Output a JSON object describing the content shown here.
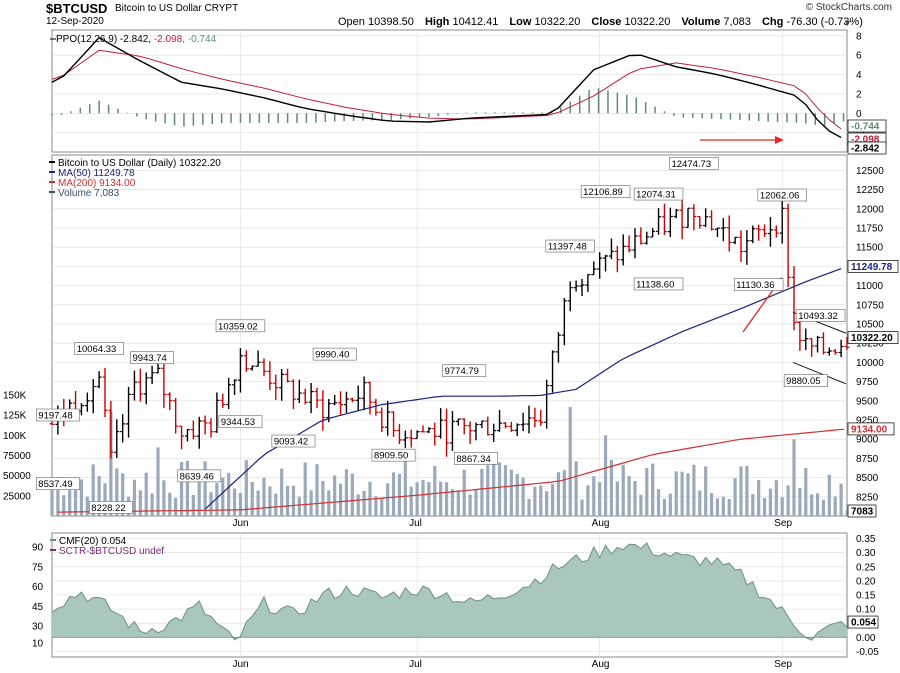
{
  "header": {
    "symbol": "$BTCUSD",
    "description": "Bitcoin to US Dollar  CRYPT",
    "date": "12-Sep-2020",
    "copyright": "© StockCharts.com",
    "open_label": "Open",
    "open": "10398.50",
    "high_label": "High",
    "high": "10412.41",
    "low_label": "Low",
    "low": "10322.20",
    "close_label": "Close",
    "close": "10322.20",
    "volume_label": "Volume",
    "volume": "7,083",
    "chg_label": "Chg",
    "chg": "-76.30 (-0.73%)",
    "dropdown_glyph": "▼"
  },
  "colors": {
    "up_bar": "#000000",
    "down_bar": "#cc0000",
    "ma50": "#1a237e",
    "ma200": "#d32f2f",
    "volume": "#9aaabb",
    "ppo_hist": "#5f8c72",
    "ppo_line": "#000000",
    "ppo_signal": "#c0203a",
    "cmf_fill": "#a9c7bf",
    "cmf_line": "#6d8f88",
    "sctr": "#7a2c7a",
    "arrow": "#ee2222",
    "grid": "#dcdcdc"
  },
  "chart_data": [
    {
      "type": "line",
      "panel": "PPO",
      "legend": "PPO(12,26,9) -2.842, -2.098, -0.744",
      "legend_parts": [
        "PPO(12,26,9) -2.842,",
        "-2.098,",
        "-0.744"
      ],
      "ylim": [
        -4,
        8.6
      ],
      "yticks": [
        8,
        6,
        4,
        2,
        0,
        -2
      ],
      "x_dates": [
        "2020-05-01",
        "2020-05-08",
        "2020-05-15",
        "2020-05-22",
        "2020-05-29",
        "2020-06-05",
        "2020-06-12",
        "2020-06-19",
        "2020-06-26",
        "2020-07-03",
        "2020-07-10",
        "2020-07-17",
        "2020-07-24",
        "2020-07-31",
        "2020-08-07",
        "2020-08-14",
        "2020-08-21",
        "2020-08-28",
        "2020-09-04",
        "2020-09-08",
        "2020-09-12"
      ],
      "series": [
        {
          "name": "PPO",
          "values": [
            3.2,
            7.8,
            5.4,
            3.2,
            2.5,
            1.6,
            0.5,
            -0.2,
            -0.8,
            -0.9,
            -0.5,
            -0.3,
            -0.1,
            4.5,
            6.2,
            4.8,
            4.0,
            2.9,
            1.7,
            -1.5,
            -2.842
          ]
        },
        {
          "name": "Signal",
          "values": [
            3.5,
            6.5,
            5.9,
            4.6,
            3.5,
            2.6,
            1.5,
            0.6,
            -0.1,
            -0.5,
            -0.6,
            -0.4,
            -0.2,
            1.8,
            4.5,
            5.2,
            4.6,
            3.7,
            2.7,
            -0.2,
            -2.098
          ]
        },
        {
          "name": "Histogram",
          "values": [
            -0.3,
            1.3,
            -0.5,
            -1.4,
            -1.0,
            -1.0,
            -1.0,
            -0.8,
            -0.7,
            -0.4,
            0.1,
            0.1,
            0.1,
            2.7,
            1.7,
            -0.4,
            -0.6,
            -0.8,
            -1.0,
            -1.3,
            -0.744
          ]
        }
      ],
      "value_tags": [
        "-0.744",
        "-2.098",
        "-2.842"
      ]
    },
    {
      "type": "bar",
      "panel": "Price",
      "legend": [
        "Bitcoin to US Dollar (Daily) 10322.20",
        "MA(50) 11249.78",
        "MA(200) 9134.00",
        "Volume 7,083"
      ],
      "ylim": [
        8000,
        12700
      ],
      "yticks": [
        12500,
        12250,
        12000,
        11750,
        11500,
        11250,
        11000,
        10750,
        10500,
        10250,
        10000,
        9750,
        9500,
        9250,
        9000,
        8750,
        8500,
        8250
      ],
      "xticks": [
        "Jun",
        "Jul",
        "Aug",
        "Sep"
      ],
      "price_path": {
        "dates": [
          "2020-04-30",
          "2020-05-08",
          "2020-05-10",
          "2020-05-14",
          "2020-05-18",
          "2020-05-22",
          "2020-05-27",
          "2020-06-01",
          "2020-06-08",
          "2020-06-15",
          "2020-06-22",
          "2020-06-27",
          "2020-07-05",
          "2020-07-15",
          "2020-07-22",
          "2020-07-27",
          "2020-08-02",
          "2020-08-10",
          "2020-08-17",
          "2020-08-25",
          "2020-09-01",
          "2020-09-03",
          "2020-09-05",
          "2020-09-08",
          "2020-09-12"
        ],
        "values": [
          9200,
          9800,
          8700,
          9700,
          9800,
          9100,
          9200,
          10100,
          9700,
          9400,
          9600,
          9100,
          9100,
          9200,
          9300,
          11100,
          11300,
          11700,
          12000,
          11500,
          11900,
          10500,
          10200,
          10150,
          10322
        ]
      },
      "series": [
        {
          "name": "MA(50)",
          "dates": [
            "2020-05-26",
            "2020-06-05",
            "2020-06-15",
            "2020-06-25",
            "2020-07-05",
            "2020-07-15",
            "2020-07-22",
            "2020-07-28",
            "2020-08-05",
            "2020-08-15",
            "2020-08-25",
            "2020-09-05",
            "2020-09-12"
          ],
          "values": [
            8090,
            8800,
            9250,
            9450,
            9560,
            9560,
            9570,
            9650,
            10050,
            10400,
            10700,
            11050,
            11250
          ]
        },
        {
          "name": "MA(200)",
          "dates": [
            "2020-05-01",
            "2020-06-01",
            "2020-07-01",
            "2020-07-25",
            "2020-08-10",
            "2020-08-25",
            "2020-09-12"
          ],
          "values": [
            8050,
            8080,
            8270,
            8450,
            8800,
            9000,
            9134
          ]
        }
      ],
      "annotations": [
        "9197.48",
        "8537.49",
        "10064.33",
        "8228.22",
        "9943.74",
        "8639.46",
        "10359.02",
        "9344.53",
        "9990.40",
        "9093.42",
        "8909.50",
        "9774.79",
        "8867.34",
        "11397.48",
        "12106.89",
        "12074.31",
        "11138.60",
        "12474.73",
        "11130.36",
        "12062.06",
        "9880.05",
        "10493.32"
      ],
      "value_tags": [
        "11249.78",
        "10322.20",
        "9134.00",
        "7083"
      ]
    },
    {
      "type": "bar",
      "panel": "Volume",
      "yticks_left": [
        "150K",
        "125K",
        "100K",
        "75000",
        "50000",
        "25000"
      ],
      "ylim": [
        0,
        150000
      ]
    },
    {
      "type": "area",
      "panel": "CMF",
      "legend": [
        "CMF(20) 0.054",
        "SCTR-$BTCUSD undef"
      ],
      "ylim": [
        -0.07,
        0.37
      ],
      "yticks_right": [
        0.35,
        0.3,
        0.25,
        0.2,
        0.15,
        0.1,
        0.05,
        0.0,
        -0.05
      ],
      "yticks_left": [
        90,
        75,
        60,
        45,
        30,
        10
      ],
      "xticks": [
        "Jun",
        "Jul",
        "Aug",
        "Sep"
      ],
      "x_dates": [
        "2020-04-30",
        "2020-05-05",
        "2020-05-10",
        "2020-05-15",
        "2020-05-20",
        "2020-05-25",
        "2020-05-31",
        "2020-06-05",
        "2020-06-10",
        "2020-06-15",
        "2020-06-20",
        "2020-06-25",
        "2020-06-30",
        "2020-07-05",
        "2020-07-10",
        "2020-07-15",
        "2020-07-20",
        "2020-07-25",
        "2020-07-30",
        "2020-08-05",
        "2020-08-10",
        "2020-08-15",
        "2020-08-20",
        "2020-08-25",
        "2020-08-30",
        "2020-09-03",
        "2020-09-06",
        "2020-09-09",
        "2020-09-12"
      ],
      "values": [
        0.11,
        0.16,
        0.1,
        0.02,
        0.05,
        0.11,
        -0.02,
        0.12,
        0.08,
        0.15,
        0.17,
        0.14,
        0.17,
        0.16,
        0.12,
        0.15,
        0.19,
        0.25,
        0.29,
        0.33,
        0.31,
        0.28,
        0.27,
        0.22,
        0.13,
        0.05,
        0.0,
        0.03,
        0.054
      ],
      "value_tags": [
        "0.054"
      ]
    }
  ]
}
